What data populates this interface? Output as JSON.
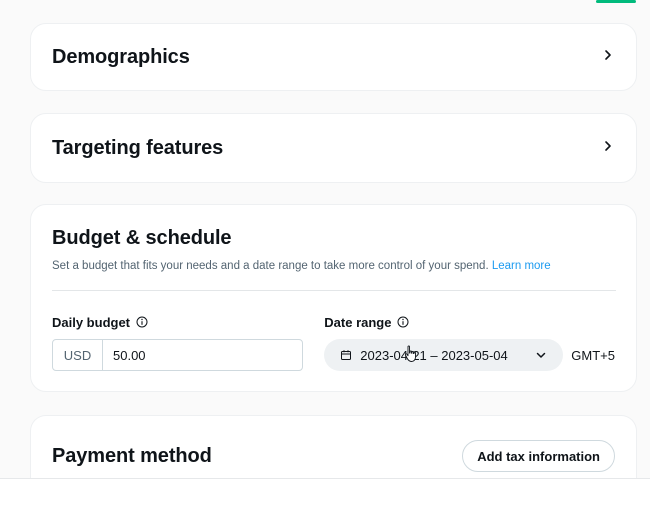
{
  "sections": {
    "demographics": {
      "title": "Demographics"
    },
    "targeting": {
      "title": "Targeting features"
    },
    "budget": {
      "title": "Budget & schedule",
      "subtitle": "Set a budget that fits your needs and a date range to take more control of your spend.",
      "learn_more": "Learn more",
      "daily_budget": {
        "label": "Daily budget",
        "currency": "USD",
        "value": "50.00"
      },
      "date_range": {
        "label": "Date range",
        "value": "2023-04-21 – 2023-05-04",
        "timezone": "GMT+5"
      }
    },
    "payment": {
      "title": "Payment method",
      "add_tax_label": "Add tax information"
    }
  },
  "colors": {
    "accent_link": "#1d9bf0",
    "accent_green": "#00ba7c",
    "text_primary": "#0f1419",
    "text_secondary": "#536471"
  },
  "icons": {
    "chevron": "chevron-right-icon",
    "info": "info-icon",
    "calendar": "calendar-icon",
    "dropdown": "chevron-down-icon"
  }
}
